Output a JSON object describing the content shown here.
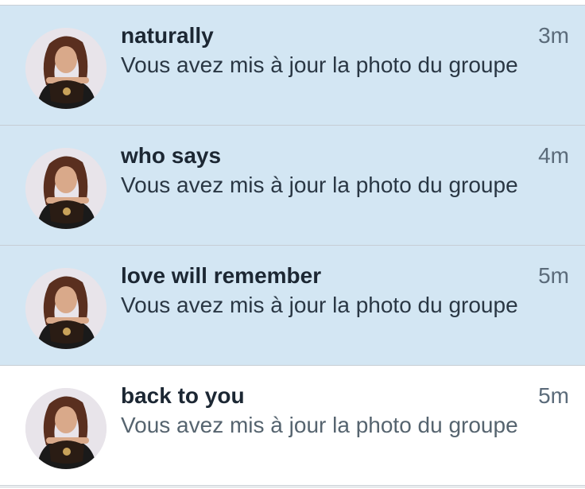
{
  "notifications": [
    {
      "title": "naturally",
      "time": "3m",
      "message": "Vous avez mis à jour la photo du groupe",
      "unread": true
    },
    {
      "title": "who says",
      "time": "4m",
      "message": "Vous avez mis à jour la photo du groupe",
      "unread": true
    },
    {
      "title": "love will remember",
      "time": "5m",
      "message": "Vous avez mis à jour la photo du groupe",
      "unread": true
    },
    {
      "title": "back to you",
      "time": "5m",
      "message": "Vous avez mis à jour la photo du groupe",
      "unread": false
    }
  ],
  "colors": {
    "unread_background": "#d3e6f3",
    "read_background": "#ffffff",
    "title_text": "#1c2733",
    "time_text": "#5b6b7a"
  }
}
